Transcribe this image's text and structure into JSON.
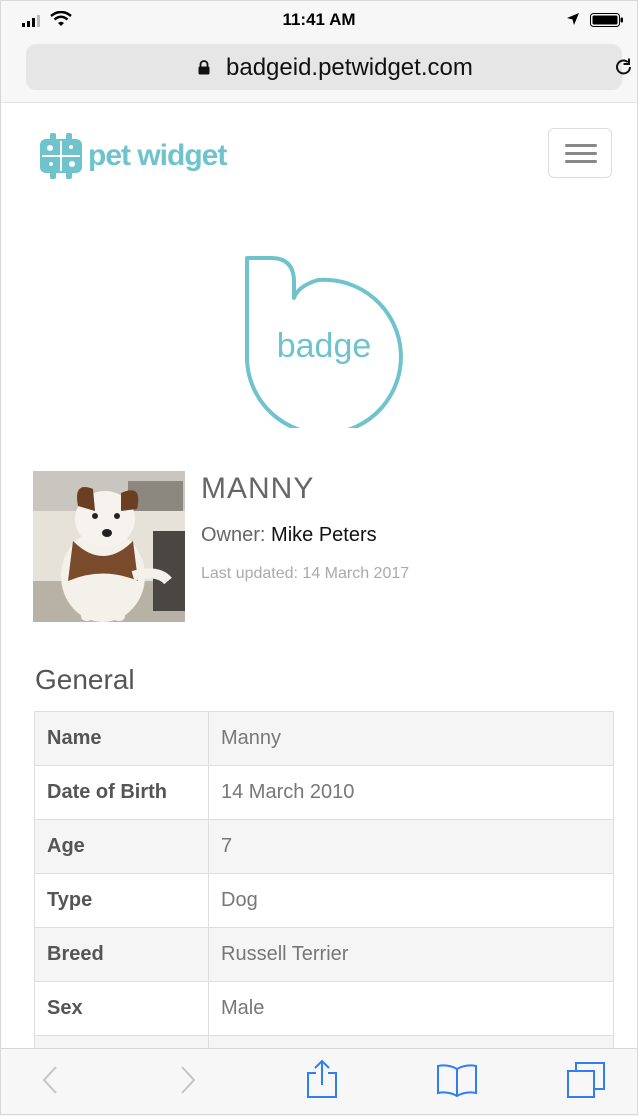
{
  "status_bar": {
    "time": "11:41 AM",
    "icons": [
      "signal-icon",
      "wifi-icon",
      "location-arrow-icon",
      "battery-icon"
    ]
  },
  "browser": {
    "url": "badgeid.petwidget.com",
    "lock_icon": "lock-icon",
    "reload_icon": "reload-icon"
  },
  "header": {
    "logo_text": "pet widget",
    "menu_icon": "hamburger-menu-icon"
  },
  "badge_logo": {
    "text": "badge"
  },
  "profile": {
    "name": "MANNY",
    "owner_label": "Owner:",
    "owner_name": "Mike Peters",
    "last_updated": "Last updated: 14 March 2017"
  },
  "general": {
    "title": "General",
    "rows": [
      {
        "label": "Name",
        "value": "Manny"
      },
      {
        "label": "Date of Birth",
        "value": "14 March 2010"
      },
      {
        "label": "Age",
        "value": "7"
      },
      {
        "label": "Type",
        "value": "Dog"
      },
      {
        "label": "Breed",
        "value": "Russell Terrier"
      },
      {
        "label": "Sex",
        "value": "Male"
      }
    ]
  },
  "toolbar": {
    "icons": [
      "back-icon",
      "forward-icon",
      "share-icon",
      "bookmarks-icon",
      "tabs-icon"
    ]
  },
  "colors": {
    "brand": "#6fc3cc",
    "browser_chrome": "#f7f7f7",
    "ios_blue": "#2f7ef6"
  }
}
